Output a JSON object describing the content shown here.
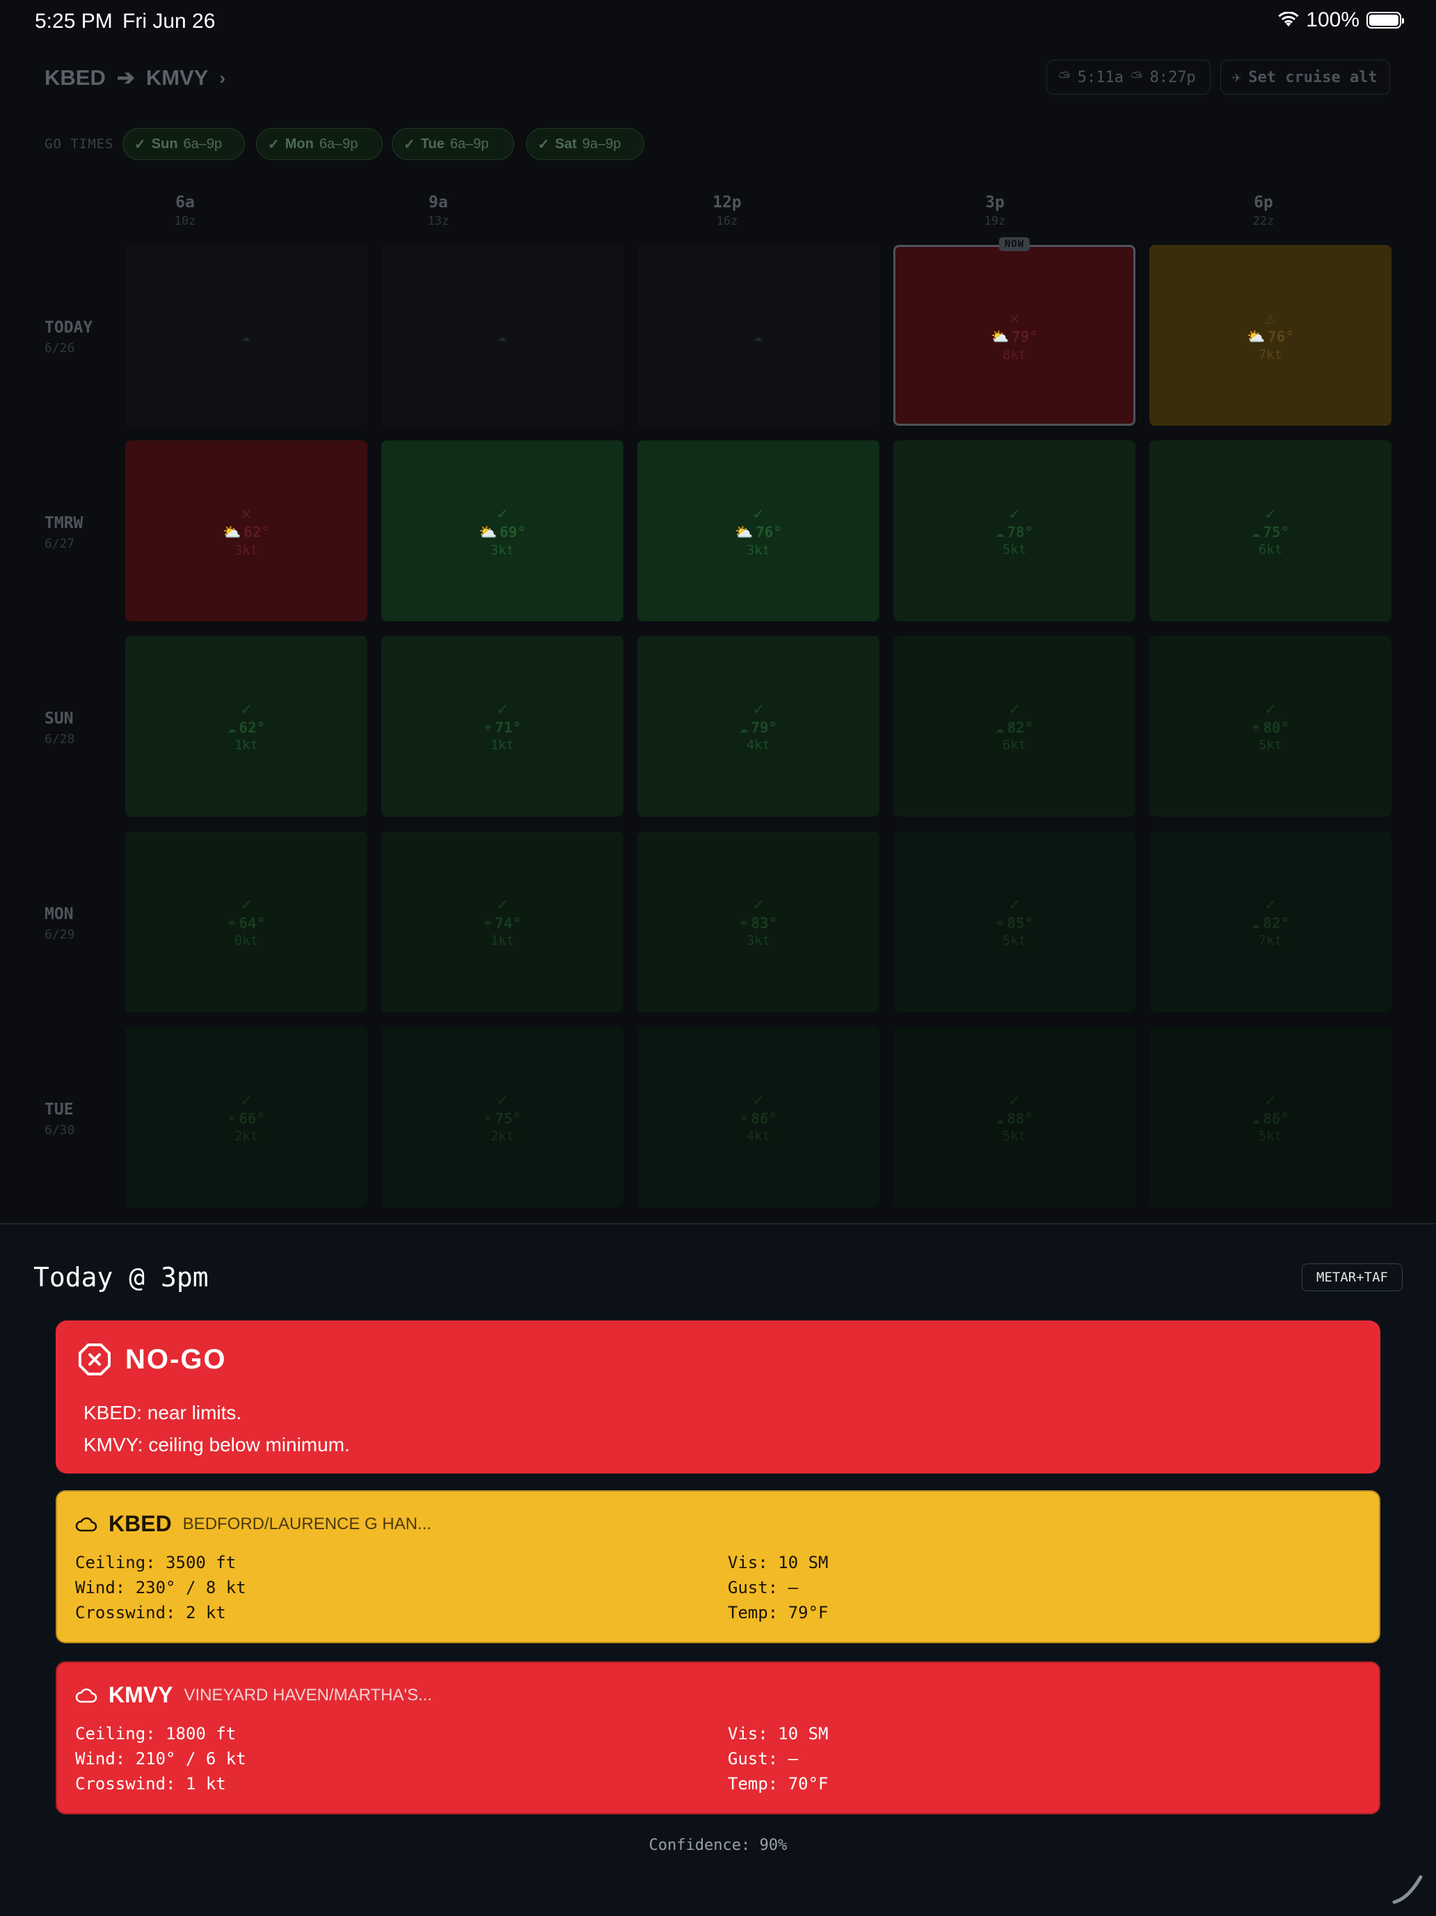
{
  "status_bar": {
    "time": "5:25 PM",
    "date": "Fri Jun 26",
    "battery": "100%"
  },
  "header": {
    "origin": "KBED",
    "destination": "KMVY",
    "sunrise": "5:11a",
    "sunset": "8:27p",
    "cruise_button": "Set cruise alt"
  },
  "go_times": {
    "label": "GO TIMES",
    "chips": [
      {
        "day": "Sun",
        "range": "6a–9p"
      },
      {
        "day": "Mon",
        "range": "6a–9p"
      },
      {
        "day": "Tue",
        "range": "6a–9p"
      },
      {
        "day": "Sat",
        "range": "9a–9p"
      }
    ]
  },
  "columns": [
    {
      "local": "6a",
      "zulu": "10z"
    },
    {
      "local": "9a",
      "zulu": "13z"
    },
    {
      "local": "12p",
      "zulu": "16z"
    },
    {
      "local": "3p",
      "zulu": "19z"
    },
    {
      "local": "6p",
      "zulu": "22z"
    }
  ],
  "now_badge": "NOW",
  "rows": [
    {
      "day": "TODAY",
      "date": "6/26",
      "cells": [
        {
          "status": "empty",
          "icon": "cloud",
          "temp": "",
          "wind": ""
        },
        {
          "status": "empty",
          "icon": "cloud",
          "temp": "",
          "wind": ""
        },
        {
          "status": "empty",
          "icon": "cloud",
          "temp": "",
          "wind": ""
        },
        {
          "status": "nogo",
          "icon": "partly-cloudy",
          "temp": "79°",
          "wind": "8kt",
          "now": true
        },
        {
          "status": "caution",
          "icon": "partly-cloudy",
          "temp": "76°",
          "wind": "7kt"
        }
      ]
    },
    {
      "day": "TMRW",
      "date": "6/27",
      "cells": [
        {
          "status": "nogo",
          "icon": "partly-cloudy",
          "temp": "62°",
          "wind": "3kt"
        },
        {
          "status": "go",
          "icon": "partly-cloudy",
          "temp": "69°",
          "wind": "3kt"
        },
        {
          "status": "go",
          "icon": "partly-cloudy",
          "temp": "76°",
          "wind": "3kt"
        },
        {
          "status": "go",
          "icon": "rain-cloud",
          "temp": "78°",
          "wind": "5kt"
        },
        {
          "status": "go",
          "icon": "rain-cloud",
          "temp": "75°",
          "wind": "6kt"
        }
      ]
    },
    {
      "day": "SUN",
      "date": "6/28",
      "cells": [
        {
          "status": "go",
          "icon": "cloud",
          "temp": "62°",
          "wind": "1kt"
        },
        {
          "status": "go",
          "icon": "sun",
          "temp": "71°",
          "wind": "1kt"
        },
        {
          "status": "go",
          "icon": "rain-cloud",
          "temp": "79°",
          "wind": "4kt"
        },
        {
          "status": "go",
          "icon": "rain-cloud",
          "temp": "82°",
          "wind": "6kt"
        },
        {
          "status": "go",
          "icon": "sun",
          "temp": "80°",
          "wind": "5kt"
        }
      ]
    },
    {
      "day": "MON",
      "date": "6/29",
      "cells": [
        {
          "status": "go",
          "icon": "sun",
          "temp": "64°",
          "wind": "0kt"
        },
        {
          "status": "go",
          "icon": "sun",
          "temp": "74°",
          "wind": "1kt"
        },
        {
          "status": "go",
          "icon": "sun",
          "temp": "83°",
          "wind": "3kt"
        },
        {
          "status": "go",
          "icon": "sun",
          "temp": "85°",
          "wind": "5kt"
        },
        {
          "status": "go",
          "icon": "cloud",
          "temp": "82°",
          "wind": "7kt"
        }
      ]
    },
    {
      "day": "TUE",
      "date": "6/30",
      "cells": [
        {
          "status": "go",
          "icon": "sun",
          "temp": "66°",
          "wind": "2kt"
        },
        {
          "status": "go",
          "icon": "sun",
          "temp": "75°",
          "wind": "2kt"
        },
        {
          "status": "go",
          "icon": "sun",
          "temp": "86°",
          "wind": "4kt"
        },
        {
          "status": "go",
          "icon": "cloud",
          "temp": "88°",
          "wind": "5kt"
        },
        {
          "status": "go",
          "icon": "rain-cloud",
          "temp": "86°",
          "wind": "5kt"
        }
      ]
    }
  ],
  "detail": {
    "title": "Today @ 3pm",
    "source_button": "METAR+TAF",
    "verdict": {
      "label": "NO-GO",
      "reasons": [
        "KBED: near limits.",
        "KMVY: ceiling below minimum."
      ],
      "color": "#e52a33"
    },
    "stations": [
      {
        "code": "KBED",
        "name": "BEDFORD/LAURENCE G HAN...",
        "color": "#f3ba27",
        "ceiling": "Ceiling: 3500 ft",
        "vis": "Vis: 10 SM",
        "wind": "Wind: 230° / 8 kt",
        "gust": "Gust: —",
        "crosswind": "Crosswind: 2 kt",
        "temp": "Temp: 79°F"
      },
      {
        "code": "KMVY",
        "name": "VINEYARD HAVEN/MARTHA'S...",
        "color": "#e52a33",
        "ceiling": "Ceiling: 1800 ft",
        "vis": "Vis: 10 SM",
        "wind": "Wind: 210° / 6 kt",
        "gust": "Gust: —",
        "crosswind": "Crosswind: 1 kt",
        "temp": "Temp: 70°F"
      }
    ],
    "confidence": "Confidence: 90%"
  }
}
